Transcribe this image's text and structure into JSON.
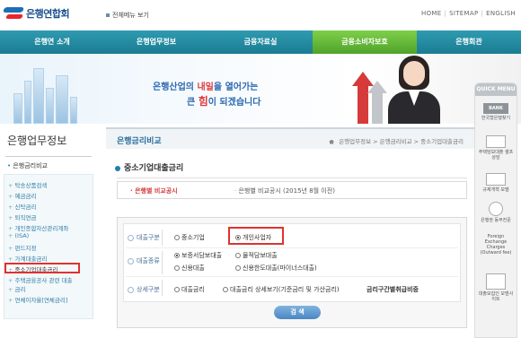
{
  "header": {
    "logo_text": "은행연합회",
    "all_menu": "전체메뉴 보기",
    "util_links": [
      "HOME",
      "SITEMAP",
      "ENGLISH"
    ]
  },
  "nav": {
    "items": [
      "은행연 소개",
      "은행업무정보",
      "금융자료실",
      "금융소비자보호",
      "은행회관"
    ],
    "active_index": 3
  },
  "banner": {
    "line1_pre": "은행산업의 ",
    "line1_em": "내일",
    "line1_post": "을 열어가는",
    "line2_pre": "큰 ",
    "line2_em": "힘",
    "line2_post": "이 되겠습니다"
  },
  "sidebar": {
    "title": "은행업무정보",
    "sub": "은행금리비교",
    "items": [
      "탁송상품검색",
      "예금금리",
      "신탁금리",
      "퇴직연금",
      "개인종합자산관리계좌",
      "(ISA)",
      "펀드지정",
      "가계대출금리",
      "중소기업대출금리",
      "주택금융공사 관련 대출",
      "금리",
      "연체이자율[연체금리]"
    ],
    "selected_index": 8
  },
  "content": {
    "section_title": "은행금리비교",
    "breadcrumb": [
      "은행업무정보",
      "은행금리비교",
      "중소기업대출금리"
    ],
    "page_title": "중소기업대출금리",
    "tabs": [
      "은행별 비교공시",
      "은행별 비교공시 (2015년 8월 이전)"
    ],
    "form": {
      "row1": {
        "label": "대출구분",
        "options": [
          "중소기업",
          "개인사업자"
        ],
        "selected": 1
      },
      "row2": {
        "label": "대출종류",
        "options": [
          "보증서담보대출",
          "물적담보대출",
          "신용대출",
          "신용한도대출(마이너스대출)"
        ],
        "selected": 0
      },
      "row3": {
        "label": "상세구분",
        "options": [
          "대출금리",
          "대출금리 상세보기(기준금리 및 가산금리)"
        ],
        "selected": -1,
        "extra": "금리구간별취급비중"
      },
      "search_label": "검 색"
    }
  },
  "quick_menu": {
    "title": "QUICK MENU",
    "bank_label": "BANK",
    "items": [
      "한국형은행찾기",
      "주택담보대출 셀프상담",
      "규제개혁 모델",
      "은행권 동무전문",
      "Foreign Exchange Charges (Outward fee)",
      "대출모집인 모범사이트"
    ]
  },
  "colors": {
    "nav": "#1a7c93",
    "nav_active": "#4fa32a",
    "highlight": "#e03131",
    "link": "#2f7fa6"
  }
}
